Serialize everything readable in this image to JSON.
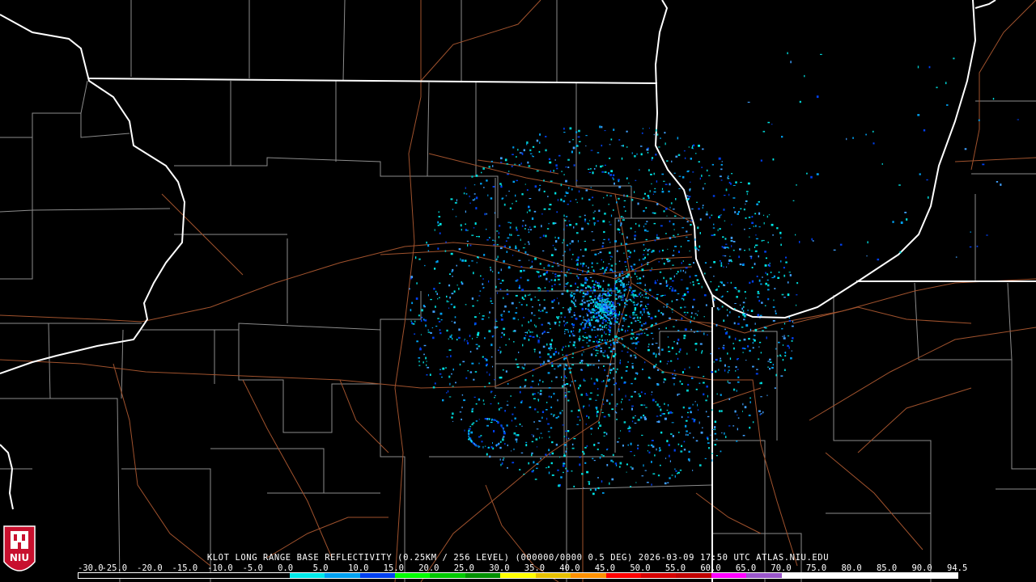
{
  "caption": "KLOT LONG RANGE BASE REFLECTIVITY (0.25KM / 256 LEVEL) (000000/0000 0.5 DEG) 2026-03-09 17:50 UTC  ATLAS.NIU.EDU",
  "logo_text": "NIU",
  "colors": {
    "background": "#000000",
    "state_border": "#ffffff",
    "county_border": "#8c8c8c",
    "highway": "#a0522d"
  },
  "scale": {
    "labels": [
      "-30.0",
      "-25.0",
      "-20.0",
      "-15.0",
      "-10.0",
      "-5.0",
      "0.0",
      "5.0",
      "10.0",
      "15.0",
      "20.0",
      "25.0",
      "30.0",
      "35.0",
      "40.0",
      "45.0",
      "50.0",
      "55.0",
      "60.0",
      "65.0",
      "70.0",
      "75.0",
      "80.0",
      "85.0",
      "90.0",
      "94.5"
    ],
    "colors": [
      "#000000",
      "#000000",
      "#000000",
      "#000000",
      "#000000",
      "#000000",
      "#00e8e8",
      "#00a0f0",
      "#0040f0",
      "#00ff00",
      "#00c800",
      "#009000",
      "#ffff00",
      "#e7c000",
      "#ff9000",
      "#ff0000",
      "#d60000",
      "#c00000",
      "#ff00ff",
      "#9955c9",
      "#ffffff",
      "#ffffff",
      "#ffffff",
      "#ffffff",
      "#ffffff"
    ]
  },
  "radar": {
    "site": "KLOT",
    "echo_colors": [
      "#00e8e8",
      "#00a0f0",
      "#0040f0",
      "#40a0ff",
      "#00c8c8"
    ]
  }
}
